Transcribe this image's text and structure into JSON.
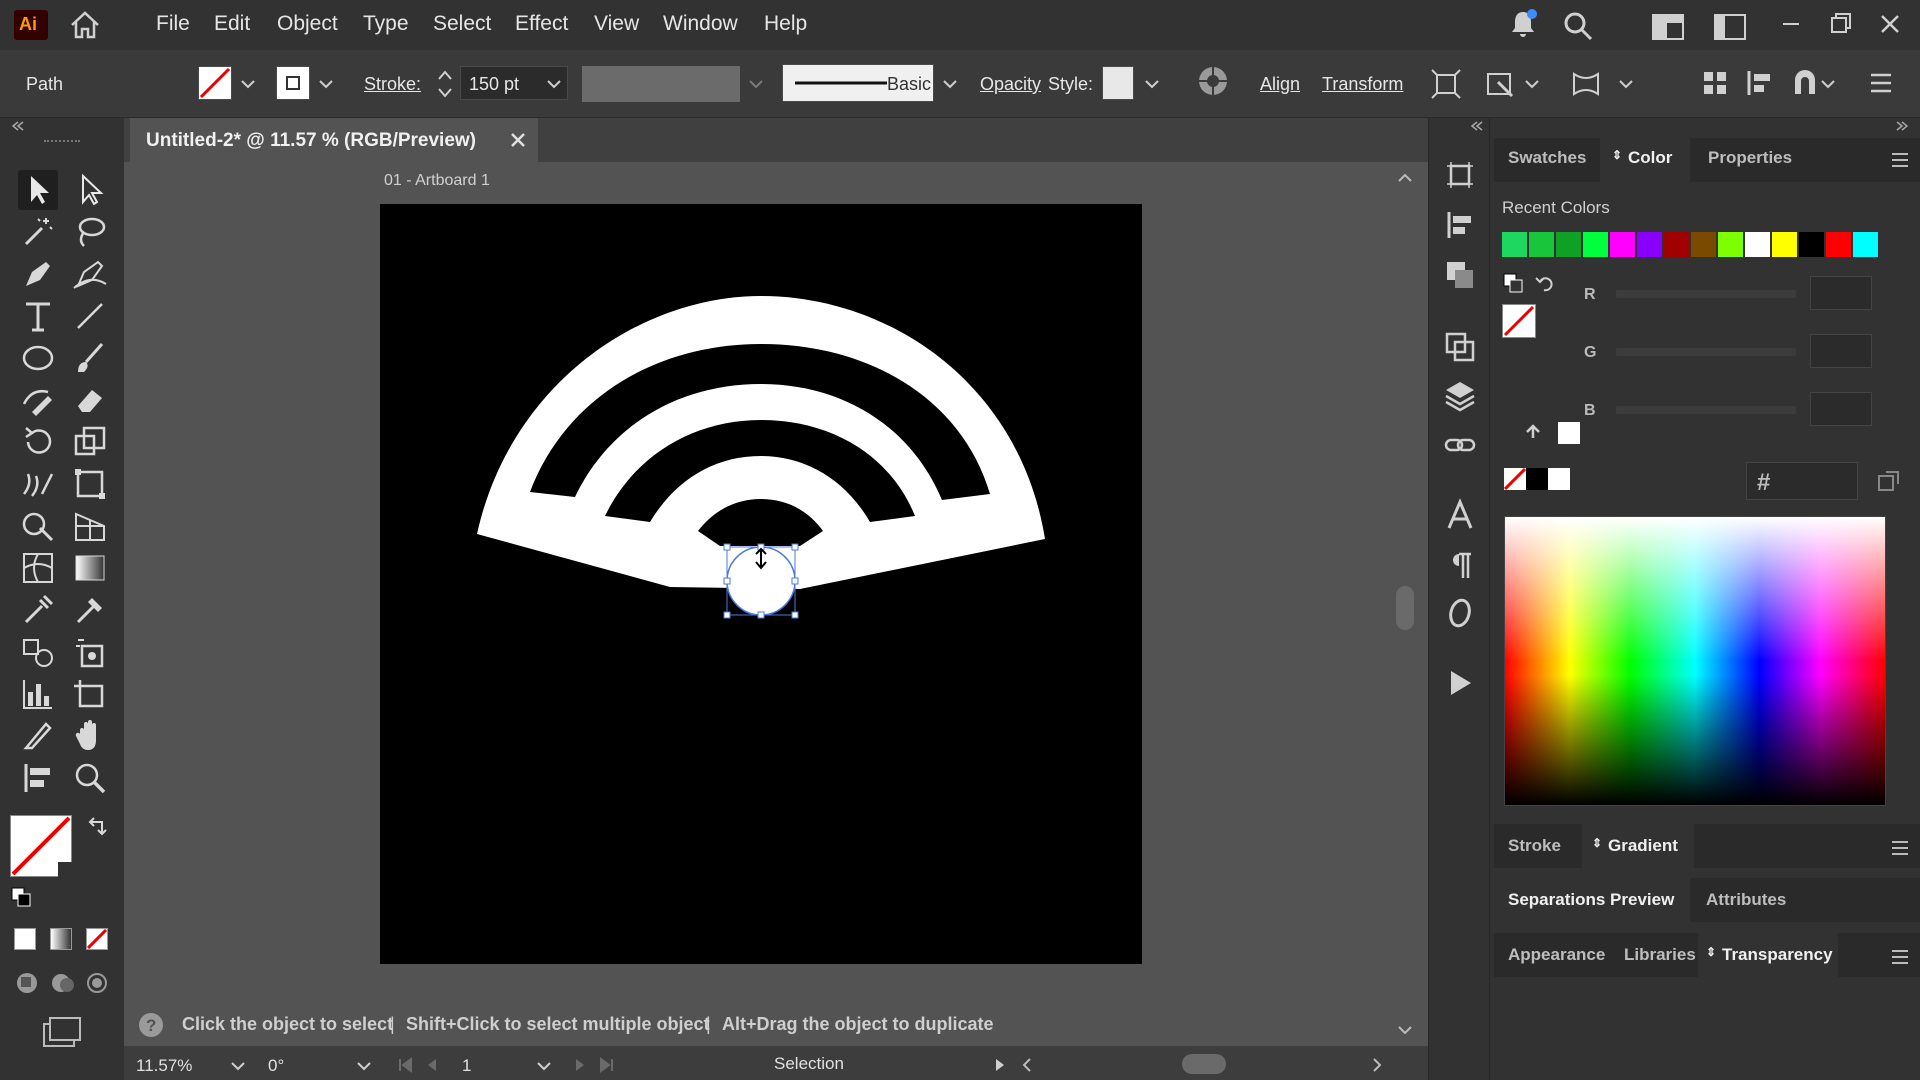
{
  "app": {
    "logo": "Ai"
  },
  "menu": [
    "File",
    "Edit",
    "Object",
    "Type",
    "Select",
    "Effect",
    "View",
    "Window",
    "Help"
  ],
  "control": {
    "selection_type": "Path",
    "stroke_label": "Stroke:",
    "stroke_value": "150 pt",
    "brush_label": "Basic",
    "opacity_label": "Opacity",
    "style_label": "Style:",
    "align_label": "Align",
    "transform_label": "Transform"
  },
  "document": {
    "tab_title": "Untitled-2* @ 11.57 % (RGB/Preview)",
    "artboard_label": "01 - Artboard 1"
  },
  "right_panel": {
    "tabs": [
      "Swatches",
      "Color",
      "Properties"
    ],
    "active_tab": "Color",
    "recent_colors_label": "Recent Colors",
    "recent_colors": [
      "#1ed760",
      "#19c53a",
      "#0fa026",
      "#00ff3c",
      "#ff00ff",
      "#8a00ff",
      "#a00000",
      "#7a4a00",
      "#7dff00",
      "#ffffff",
      "#ffff00",
      "#000000",
      "#ff0000",
      "#00ffff"
    ],
    "channels": [
      "R",
      "G",
      "B"
    ],
    "hex_symbol": "#",
    "bottom_tabs_1": [
      "Stroke",
      "Gradient"
    ],
    "bottom_tabs_2": [
      "Separations Preview",
      "Attributes"
    ],
    "bottom_tabs_3": [
      "Appearance",
      "Libraries",
      "Transparency"
    ]
  },
  "status": {
    "hint_1": "Click the object to select",
    "hint_2": "Shift+Click to select multiple object",
    "hint_3": "Alt+Drag the object to duplicate",
    "zoom": "11.57%",
    "rotation": "0°",
    "artboard_number": "1",
    "mode": "Selection"
  },
  "colors": {
    "accent_selection": "#4a7ae0",
    "canvas": "#000000",
    "artwork": "#ffffff"
  }
}
